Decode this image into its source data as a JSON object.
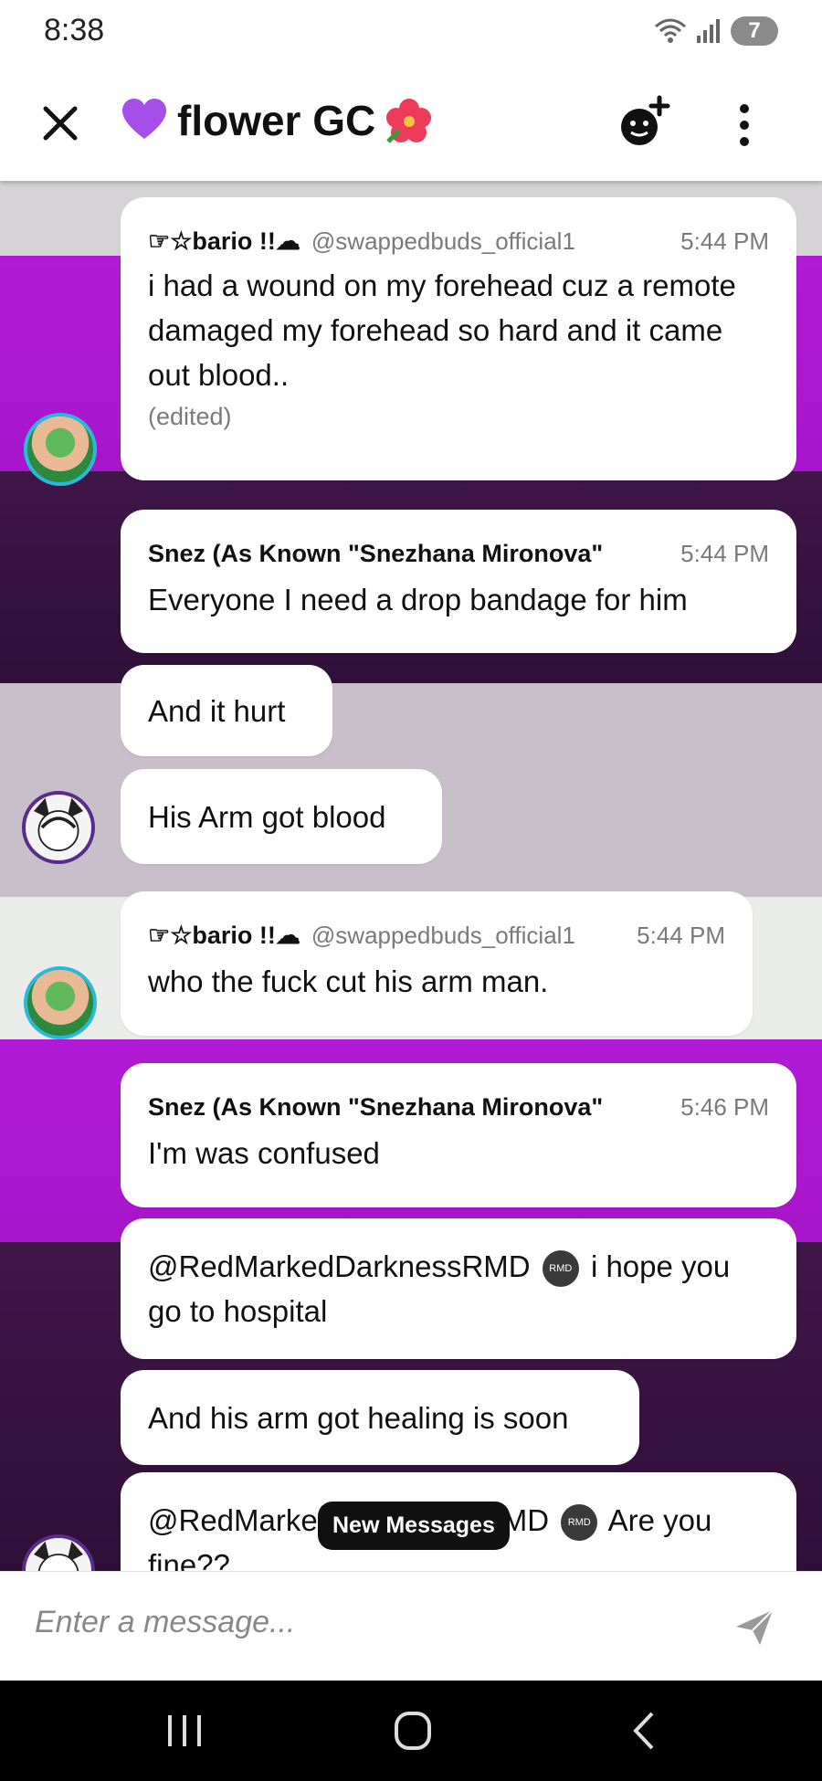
{
  "status_bar": {
    "time": "8:38",
    "battery": "7",
    "wifi_label": "5"
  },
  "header": {
    "title": "flower GC",
    "title_emoji_left": "purple-heart",
    "title_emoji_right": "hibiscus"
  },
  "messages": [
    {
      "sender": "☞☆bario !!☁",
      "handle": "@swappedbuds_official1",
      "time": "5:44 PM",
      "text": "i had a wound on my forehead cuz a remote damaged my forehead so hard and it came out blood..",
      "edited": "(edited)"
    },
    {
      "sender": "Snez (As Known \"Snezhana Mironova\"",
      "time": "5:44 PM",
      "text": "Everyone I need a drop bandage for him"
    },
    {
      "text": "And it hurt"
    },
    {
      "text": "His Arm got blood"
    },
    {
      "sender": "☞☆bario !!☁",
      "handle": "@swappedbuds_official1",
      "time": "5:44 PM",
      "text": "who the fuck cut his arm man."
    },
    {
      "sender": "Snez (As Known \"Snezhana Mironova\"",
      "time": "5:46 PM",
      "text": "I'm was confused"
    },
    {
      "mention": "@RedMarkedDarknessRMD",
      "badge": "RMD",
      "text_after": " i hope you go to hospital"
    },
    {
      "text": "And his arm got healing is soon"
    },
    {
      "mention_start": "@RedMarke",
      "mention_end": "MD",
      "badge": "RMD",
      "text_after": " Are you",
      "text_line2": "fine??"
    }
  ],
  "new_messages_label": "New Messages",
  "input": {
    "placeholder": "Enter a message..."
  },
  "colors": {
    "magenta": "#b21ad6",
    "dark_purple": "#3f1648",
    "lavender": "#c9bfca"
  }
}
